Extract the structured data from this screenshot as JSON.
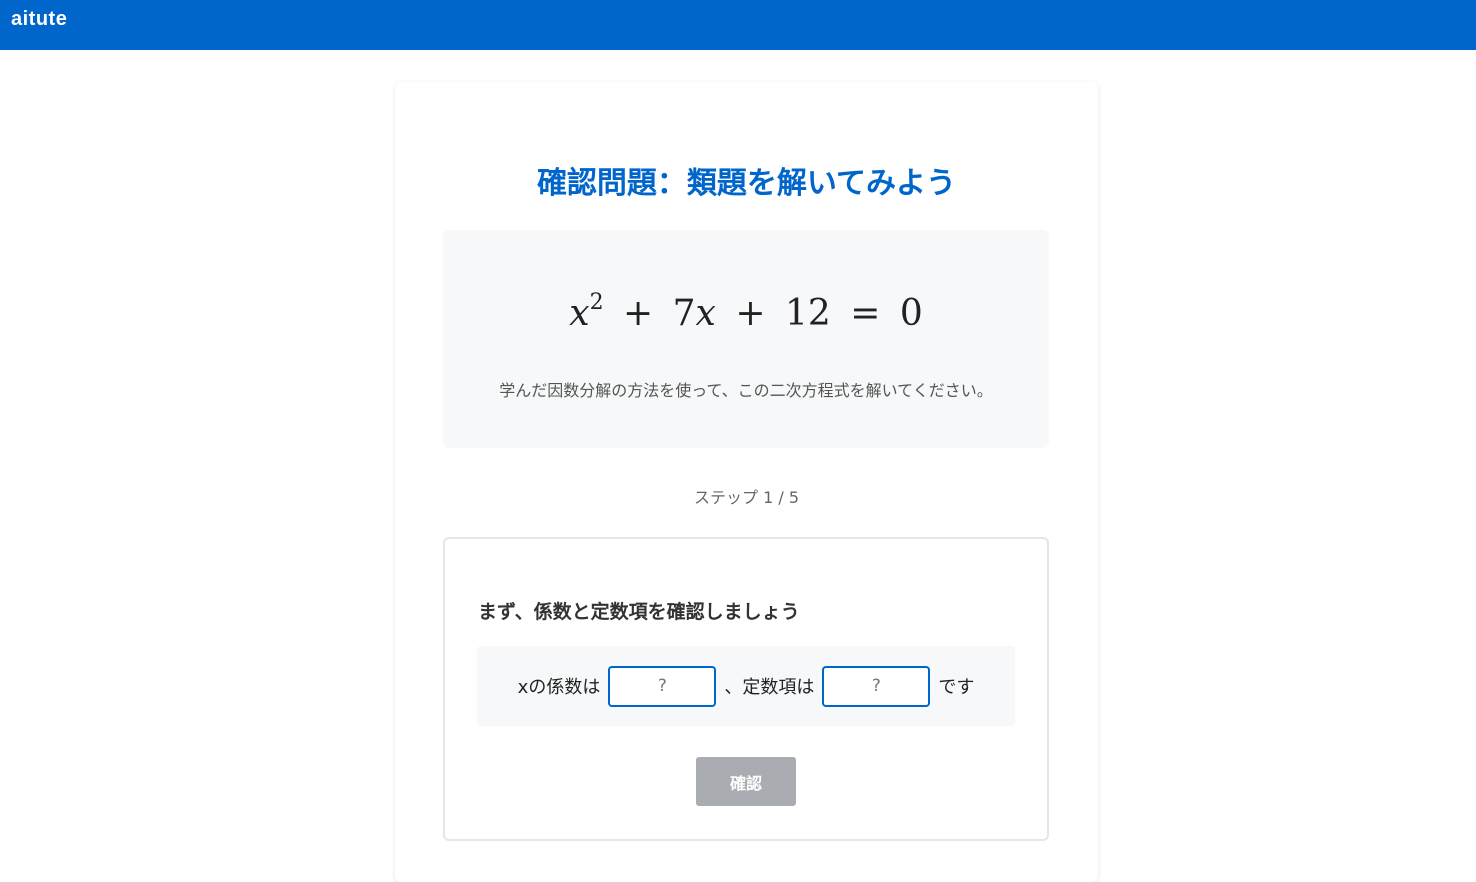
{
  "app": {
    "brand": "aitute"
  },
  "header": {
    "title": "確認問題：類題を解いてみよう"
  },
  "problem": {
    "equation": {
      "var": "x",
      "exponent": "2",
      "op1": "+",
      "term2": "7",
      "var2": "x",
      "op2": "+",
      "const": "12",
      "eq": "=",
      "rhs": "0"
    },
    "instructions": "学んだ因数分解の方法を使って、この二次方程式を解いてください。"
  },
  "progress": {
    "step_label": "ステップ 1 / 5"
  },
  "step": {
    "question": "まず、係数と定数項を確認しましょう",
    "coef_label": "xの係数は",
    "coef_placeholder": "?",
    "const_label": "、定数項は",
    "const_placeholder": "?",
    "suffix": "です",
    "confirm_label": "確認"
  },
  "colors": {
    "accent": "#0066cc",
    "panel_bg": "#f7f8f9",
    "button_disabled": "#a9acb0"
  }
}
